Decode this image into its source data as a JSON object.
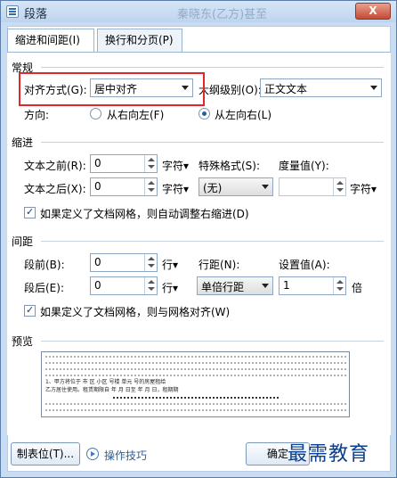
{
  "window": {
    "title": "段落",
    "ghost_title": "秦晓东(乙方)甚至",
    "close_label": "X"
  },
  "tabs": [
    {
      "label": "缩进和间距(I)",
      "active": true
    },
    {
      "label": "换行和分页(P)",
      "active": false
    }
  ],
  "general": {
    "section_label": "常规",
    "align_label": "对齐方式(G):",
    "align_value": "居中对齐",
    "outline_label": "大纲级别(O):",
    "outline_value": "正文文本",
    "direction_label": "方向:",
    "rtl_label": "从右向左(F)",
    "ltr_label": "从左向右(L)"
  },
  "indent": {
    "section_label": "缩进",
    "before_label": "文本之前(R):",
    "before_value": "0",
    "before_unit": "字符▾",
    "after_label": "文本之后(X):",
    "after_value": "0",
    "after_unit": "字符▾",
    "special_label": "特殊格式(S):",
    "special_value": "(无)",
    "measure_label": "度量值(Y):",
    "measure_value": "",
    "measure_unit": "字符▾",
    "grid_check_label": "如果定义了文档网格，则自动调整右缩进(D)"
  },
  "spacing": {
    "section_label": "间距",
    "before_label": "段前(B):",
    "before_value": "0",
    "before_unit": "行▾",
    "after_label": "段后(E):",
    "after_value": "0",
    "after_unit": "行▾",
    "line_label": "行距(N):",
    "line_value": "单倍行距",
    "setting_label": "设置值(A):",
    "setting_value": "1",
    "setting_unit": "倍",
    "grid_check_label": "如果定义了文档网格，则与网格对齐(W)"
  },
  "preview": {
    "section_label": "预览",
    "sample_text_1": "1、甲方将位于    市    区    小区    号楼    单元    号的房屋租给",
    "sample_text_2": "乙方居住使用。租赁期限自    年    月    日至    年    月    日，租期期"
  },
  "footer": {
    "tabs_button": "制表位(T)...",
    "tips_link": "操作技巧",
    "ok_button": "确定"
  },
  "watermark": "最需教育"
}
